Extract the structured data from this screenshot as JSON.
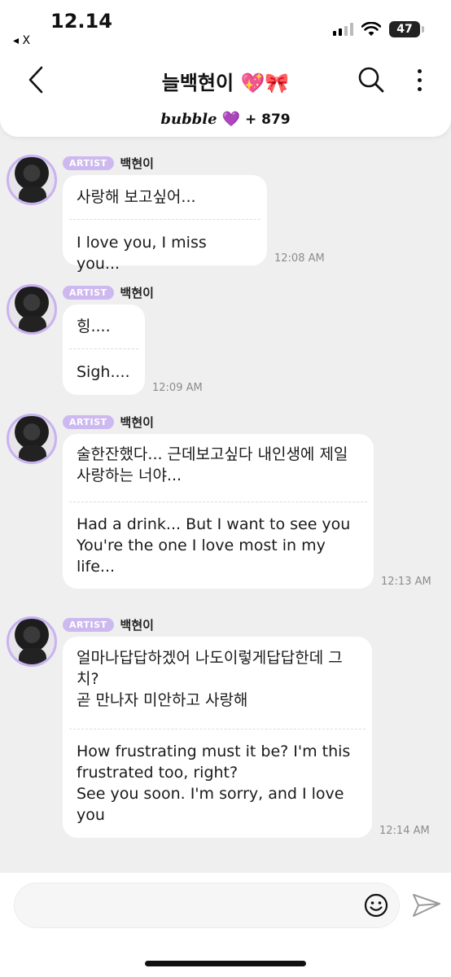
{
  "status_bar": {
    "time": "12.14",
    "back_app": "◂ X",
    "battery": "47"
  },
  "header": {
    "title": "늘백현이 💖🎀",
    "bubble_logo": "bubble",
    "bubble_heart": "💜",
    "bubble_count": "+ 879"
  },
  "messages": [
    {
      "badge": "ARTIST",
      "sender": "백현이",
      "korean": "사랑해 보고싶어...",
      "english": "I love you, I miss you...",
      "time": "12:08 AM"
    },
    {
      "badge": "ARTIST",
      "sender": "백현이",
      "korean": "힝....",
      "english": "Sigh....",
      "time": "12:09 AM"
    },
    {
      "badge": "ARTIST",
      "sender": "백현이",
      "korean": "술한잔했다... 근데보고싶다 내인생에 제일\n사랑하는 너야...",
      "english": "Had a drink... But I want to see you\nYou're the one I love most in my\nlife...",
      "time": "12:13 AM"
    },
    {
      "badge": "ARTIST",
      "sender": "백현이",
      "korean": "얼마나답답하겠어 나도이렇게답답한데 그\n치?\n곧 만나자 미안하고 사랑해",
      "english": "How frustrating must it be? I'm this\nfrustrated too, right?\nSee you soon. I'm sorry, and I love\nyou",
      "time": "12:14 AM"
    }
  ],
  "composer": {
    "placeholder": ""
  },
  "icons": {
    "back": "chevron-left-icon",
    "search": "search-icon",
    "more": "more-vertical-icon",
    "emoji": "smiley-icon",
    "send": "paper-plane-icon"
  }
}
